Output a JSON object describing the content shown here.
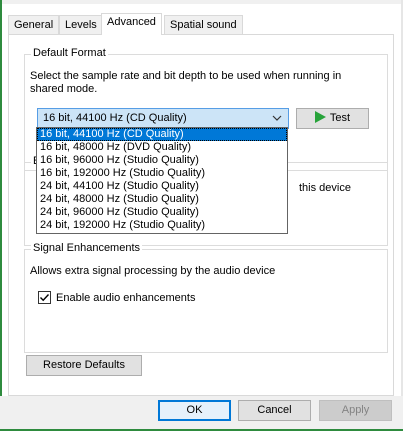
{
  "tabs": [
    {
      "label": "General"
    },
    {
      "label": "Levels"
    },
    {
      "label": "Advanced"
    },
    {
      "label": "Spatial sound"
    }
  ],
  "default_format": {
    "title": "Default Format",
    "description": "Select the sample rate and bit depth to be used when running in shared mode.",
    "selected_value": "16 bit, 44100 Hz (CD Quality)",
    "test_label": "Test",
    "options": [
      "16 bit, 44100 Hz (CD Quality)",
      "16 bit, 48000 Hz (DVD Quality)",
      "16 bit, 96000 Hz (Studio Quality)",
      "16 bit, 192000 Hz (Studio Quality)",
      "24 bit, 44100 Hz (Studio Quality)",
      "24 bit, 48000 Hz (Studio Quality)",
      "24 bit, 96000 Hz (Studio Quality)",
      "24 bit, 192000 Hz (Studio Quality)"
    ]
  },
  "exclusive_mode": {
    "title_fragment": "E",
    "text_fragment": "this device"
  },
  "signal_enhancements": {
    "title": "Signal Enhancements",
    "description": "Allows extra signal processing by the audio device",
    "checkbox_label": "Enable audio enhancements",
    "checked": true
  },
  "restore_defaults_label": "Restore Defaults",
  "footer": {
    "ok_label": "OK",
    "cancel_label": "Cancel",
    "apply_label": "Apply"
  },
  "colors": {
    "accent": "#0078d7",
    "test_icon": "#27a33a"
  }
}
